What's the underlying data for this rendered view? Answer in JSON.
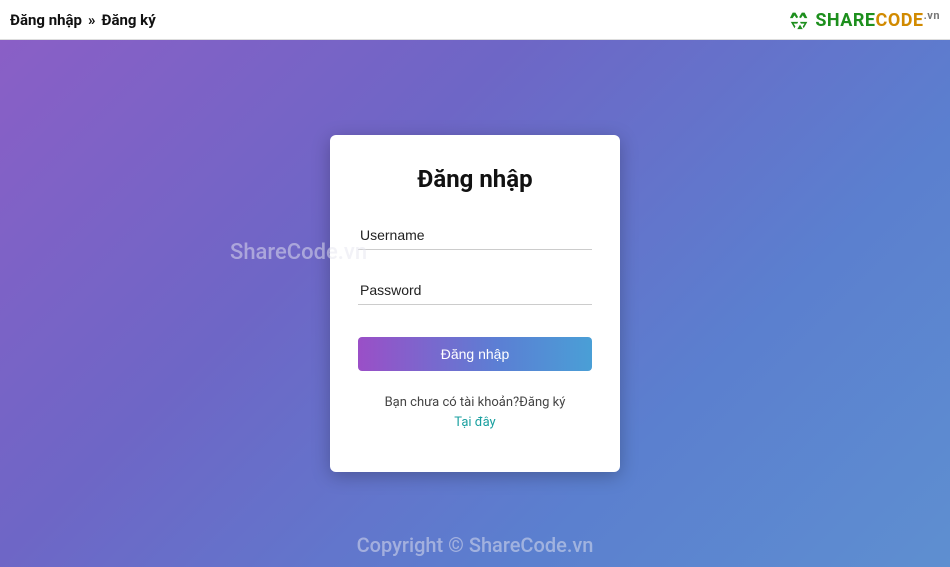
{
  "topbar": {
    "nav_login": "Đăng nhập",
    "nav_separator": "»",
    "nav_register": "Đăng ký",
    "logo_text_1": "SHARE",
    "logo_text_2": "CODE",
    "logo_text_3": ".vn"
  },
  "login_card": {
    "title": "Đăng nhập",
    "username_placeholder": "Username",
    "username_value": "",
    "password_placeholder": "Password",
    "password_value": "",
    "submit_label": "Đăng nhập",
    "signup_prompt": "Bạn chưa có tài khoản?Đăng ký",
    "signup_link": "Tại đây"
  },
  "watermarks": {
    "w1": "ShareCode.vn",
    "w2": "Copyright © ShareCode.vn"
  }
}
